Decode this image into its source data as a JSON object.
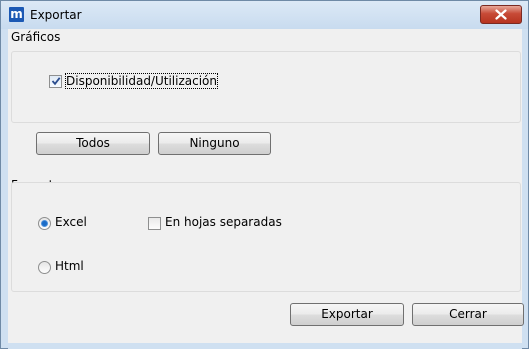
{
  "window": {
    "title": "Exportar",
    "logo_letter": "m",
    "close_symbol": "x"
  },
  "graficos": {
    "label": "Gráficos",
    "checkbox": {
      "label": "Disponibilidad/Utilización",
      "checked": true
    },
    "buttons": {
      "all": "Todos",
      "none": "Ninguno"
    }
  },
  "formato": {
    "label": "Formato",
    "excel": {
      "label": "Excel",
      "selected": true
    },
    "separate_sheets": {
      "label": "En hojas separadas",
      "checked": false
    },
    "html": {
      "label": "Html",
      "selected": false
    }
  },
  "footer": {
    "export": "Exportar",
    "close": "Cerrar"
  },
  "icons": {
    "app": "app-logo-icon",
    "close": "close-icon",
    "check": "checkmark-icon"
  }
}
